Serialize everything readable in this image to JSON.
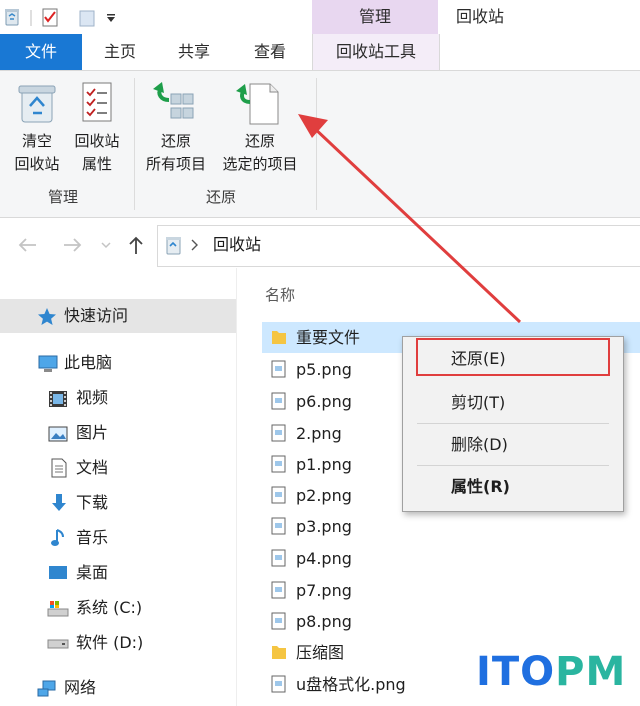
{
  "titlebar": {
    "context_tab_header": "管理",
    "window_title": "回收站",
    "qat_separator": "|"
  },
  "ribbon_tabs": [
    "文件",
    "主页",
    "共享",
    "查看",
    "回收站工具"
  ],
  "ribbon": {
    "group_manage": {
      "label": "管理",
      "empty_line1": "清空",
      "empty_line2": "回收站",
      "props_line1": "回收站",
      "props_line2": "属性"
    },
    "group_restore": {
      "label": "还原",
      "restore_all_line1": "还原",
      "restore_all_line2": "所有项目",
      "restore_sel_line1": "还原",
      "restore_sel_line2": "选定的项目"
    }
  },
  "address": {
    "path": "回收站"
  },
  "nav": {
    "items": [
      {
        "label": "快速访问",
        "icon": "star-icon"
      },
      {
        "label": "此电脑",
        "icon": "computer-icon"
      },
      {
        "label": "视频",
        "icon": "video-icon"
      },
      {
        "label": "图片",
        "icon": "pictures-icon"
      },
      {
        "label": "文档",
        "icon": "documents-icon"
      },
      {
        "label": "下载",
        "icon": "download-icon"
      },
      {
        "label": "音乐",
        "icon": "music-icon"
      },
      {
        "label": "桌面",
        "icon": "desktop-icon"
      },
      {
        "label": "系统 (C:)",
        "icon": "drive-c-icon"
      },
      {
        "label": "软件 (D:)",
        "icon": "drive-d-icon"
      },
      {
        "label": "网络",
        "icon": "network-icon"
      }
    ]
  },
  "files": {
    "column_name": "名称",
    "rows": [
      {
        "name": "重要文件",
        "type": "folder"
      },
      {
        "name": "p5.png",
        "type": "image"
      },
      {
        "name": "p6.png",
        "type": "image"
      },
      {
        "name": "2.png",
        "type": "image"
      },
      {
        "name": "p1.png",
        "type": "image"
      },
      {
        "name": "p2.png",
        "type": "image"
      },
      {
        "name": "p3.png",
        "type": "image"
      },
      {
        "name": "p4.png",
        "type": "image"
      },
      {
        "name": "p7.png",
        "type": "image"
      },
      {
        "name": "p8.png",
        "type": "image"
      },
      {
        "name": "压缩图",
        "type": "folder"
      },
      {
        "name": "u盘格式化.png",
        "type": "image"
      }
    ]
  },
  "context_menu": {
    "items": [
      "还原(E)",
      "剪切(T)",
      "删除(D)",
      "属性(R)"
    ]
  },
  "watermark": {
    "text": "ITOPM"
  },
  "colors": {
    "accent": "#1978d4",
    "context_tab": "#e8d7f0",
    "selection": "#cde8ff",
    "annotation_red": "#e03e3e",
    "watermark_blue": "#1f6fe0",
    "watermark_green": "#2ab5a0"
  }
}
